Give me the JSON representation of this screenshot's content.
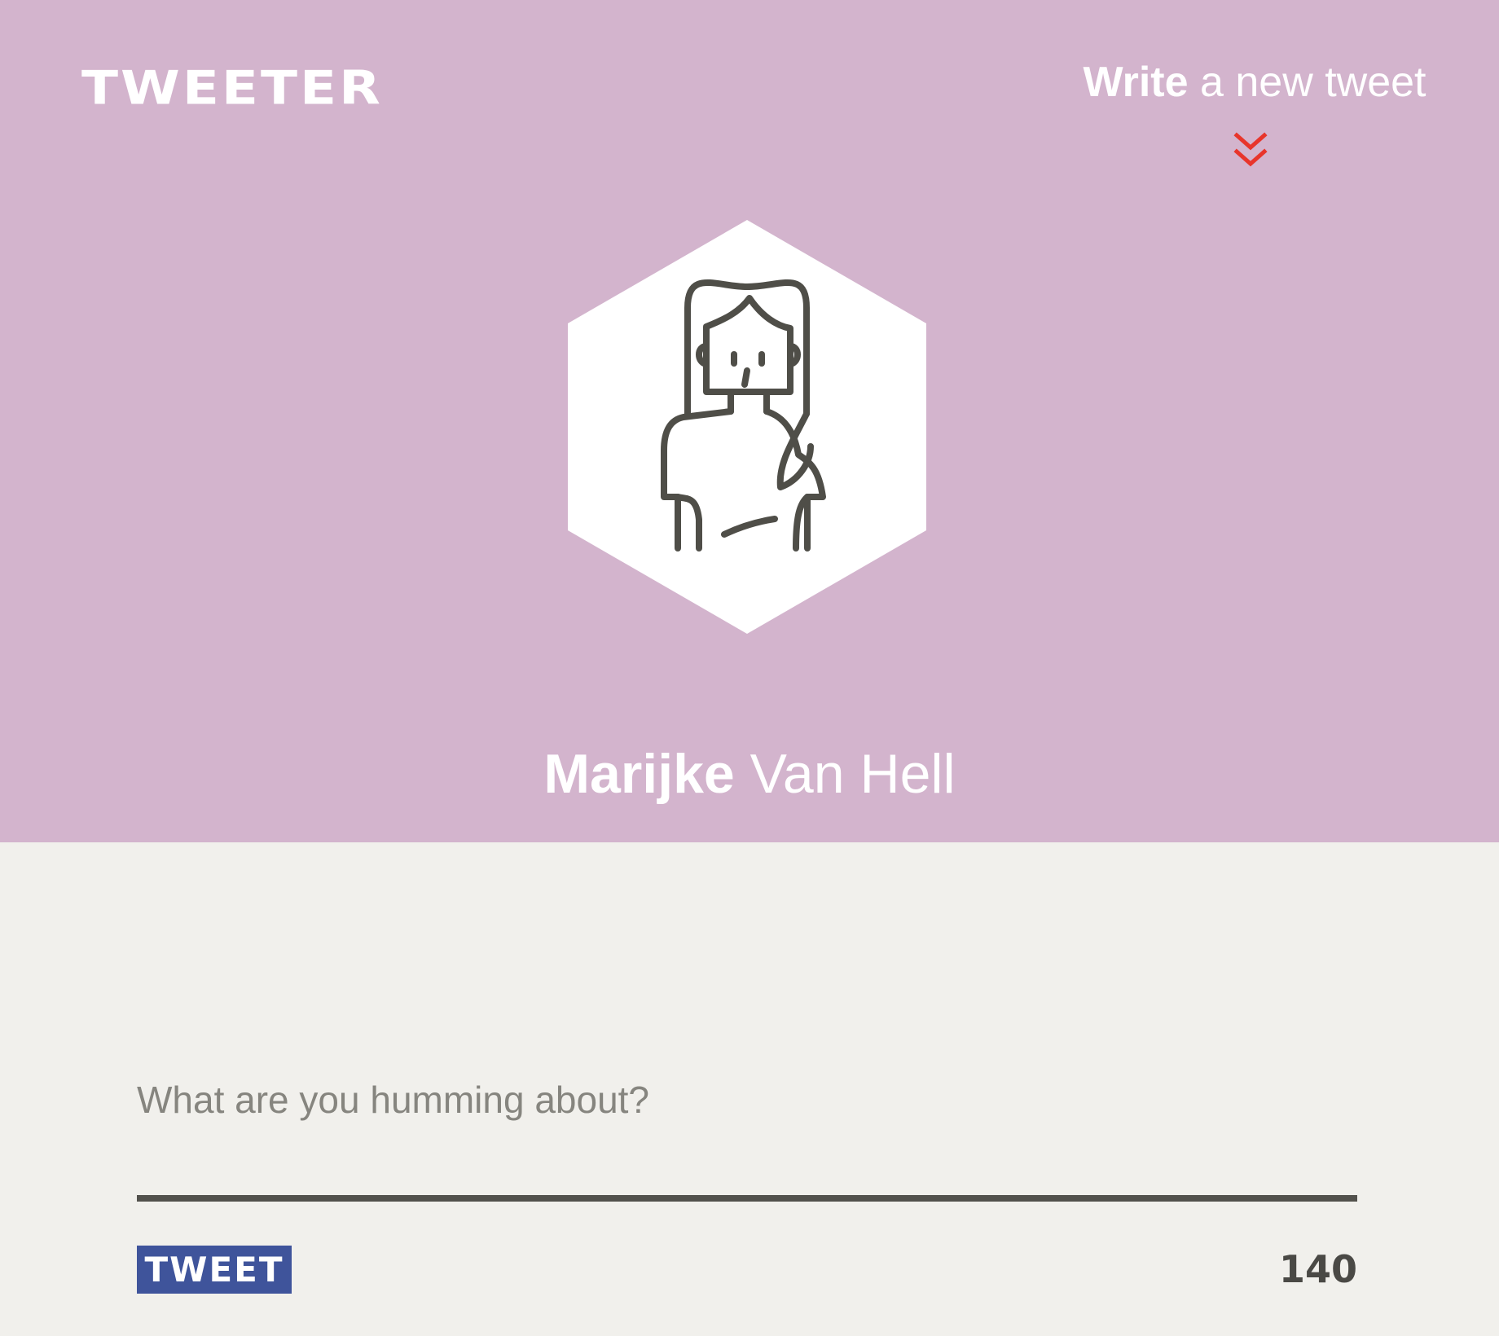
{
  "header": {
    "logo": "TWEETER",
    "write_link": {
      "bold": "Write",
      "rest": " a new tweet"
    },
    "accent_color": "#e8352b"
  },
  "profile": {
    "first_name": "Marijke",
    "last_name": " Van Hell",
    "avatar_icon": "woman-avatar-icon"
  },
  "composer": {
    "placeholder": "What are you humming about?",
    "value": "",
    "submit_label": "TWEET",
    "char_count": "140"
  },
  "colors": {
    "hero_bg": "#d3b4cd",
    "page_bg": "#f1f0ec",
    "button_bg": "#3f549b",
    "line_color": "#52514c"
  }
}
